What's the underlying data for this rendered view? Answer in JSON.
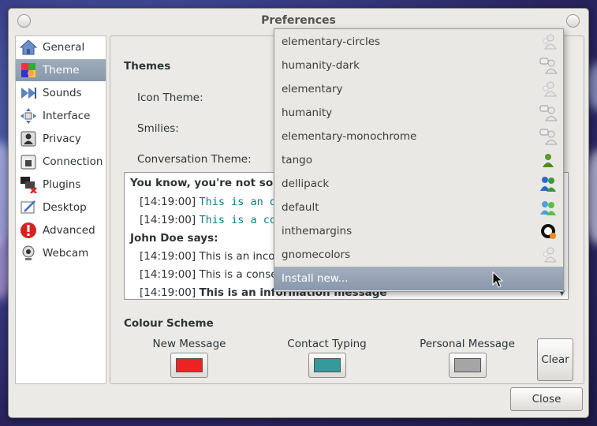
{
  "window": {
    "title": "Preferences"
  },
  "sidebar": {
    "items": [
      {
        "label": "General",
        "icon": "home-icon"
      },
      {
        "label": "Theme",
        "icon": "theme-icon",
        "active": true
      },
      {
        "label": "Sounds",
        "icon": "sounds-icon"
      },
      {
        "label": "Interface",
        "icon": "interface-icon"
      },
      {
        "label": "Privacy",
        "icon": "privacy-icon"
      },
      {
        "label": "Connection",
        "icon": "connection-icon"
      },
      {
        "label": "Plugins",
        "icon": "plugins-icon"
      },
      {
        "label": "Desktop",
        "icon": "desktop-icon"
      },
      {
        "label": "Advanced",
        "icon": "advanced-icon"
      },
      {
        "label": "Webcam",
        "icon": "webcam-icon"
      }
    ]
  },
  "themes": {
    "heading": "Themes",
    "icon_theme_label": "Icon Theme:",
    "smilies_label": "Smilies:",
    "conversation_theme_label": "Conversation Theme:"
  },
  "preview": {
    "lines": [
      {
        "time": "",
        "text": "You know, you're not some"
      },
      {
        "time": "[14:19:00]",
        "text": "This is an o"
      },
      {
        "time": "[14:19:00]",
        "text": "This is a co"
      },
      {
        "time": "",
        "text": "John Doe says:"
      },
      {
        "time": "[14:19:00]",
        "text": "This is an incom"
      },
      {
        "time": "[14:19:00]",
        "text": "This is a consecu"
      },
      {
        "time": "[14:19:00]",
        "text": "This is an information message"
      }
    ]
  },
  "colour_scheme": {
    "heading": "Colour Scheme",
    "new_message_label": "New Message",
    "contact_typing_label": "Contact Typing",
    "personal_message_label": "Personal Message",
    "colors": {
      "new_message": "#ee2222",
      "contact_typing": "#339999",
      "personal_message": "#a5a5a5"
    },
    "clear_label": "Clear"
  },
  "footer": {
    "close_label": "Close"
  },
  "dropdown": {
    "items": [
      {
        "label": "elementary-circles",
        "icon": "ghost-users-icon"
      },
      {
        "label": "humanity-dark",
        "icon": "chat-users-icon"
      },
      {
        "label": "elementary",
        "icon": "ghost-users-icon"
      },
      {
        "label": "humanity",
        "icon": "chat-users-icon"
      },
      {
        "label": "elementary-monochrome",
        "icon": "chat-users-icon"
      },
      {
        "label": "tango",
        "icon": "green-user-icon"
      },
      {
        "label": "dellipack",
        "icon": "blue-users-icon"
      },
      {
        "label": "default",
        "icon": "msn-users-icon"
      },
      {
        "label": "inthemargins",
        "icon": "ring-icon"
      },
      {
        "label": "gnomecolors",
        "icon": "ghost-users-icon"
      }
    ],
    "install_label": "Install new..."
  }
}
